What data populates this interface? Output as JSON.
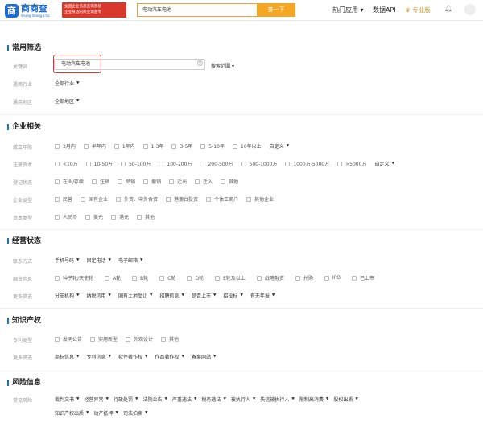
{
  "header": {
    "logo_text": "商商查",
    "logo_pinyin": "Shang Shang Cha",
    "logo_mark": "商",
    "promo_line1": "全国企业信息查询系统",
    "promo_line2": "企业身边的商业调查专",
    "search_value": "电动汽车电池",
    "search_button": "查一下",
    "nav_hot": "热门应用",
    "nav_api": "数据API",
    "nav_pro": "专业版"
  },
  "common": {
    "title": "常用筛选",
    "keyword_label": "关键词",
    "keyword_value": "电动汽车电池",
    "scope": "搜索范围",
    "industry_label": "通用行业",
    "industry_value": "全部行业",
    "region_label": "通用地区",
    "region_value": "全部地区"
  },
  "company": {
    "title": "企业相关",
    "rows": [
      {
        "label": "成立年限",
        "options": [
          "3月内",
          "半年内",
          "1年内",
          "1-3年",
          "3-5年",
          "5-10年",
          "10年以上"
        ],
        "dropdown": "自定义"
      },
      {
        "label": "注册资本",
        "options": [
          "<10万",
          "10-50万",
          "50-100万",
          "100-200万",
          "200-500万",
          "500-1000万",
          "1000万-5000万",
          ">5000万"
        ],
        "dropdown": "自定义"
      },
      {
        "label": "登记状态",
        "options": [
          "在业/存续",
          "注销",
          "吊销",
          "撤销",
          "迁出",
          "迁入",
          "其他"
        ]
      },
      {
        "label": "企业类型",
        "options": [
          "民营",
          "国有企业",
          "外资、中外合资",
          "港澳台投资",
          "个体工商户",
          "其他企业"
        ]
      },
      {
        "label": "资本类型",
        "options": [
          "人民币",
          "美元",
          "港元",
          "其他"
        ]
      }
    ]
  },
  "operation": {
    "title": "经营状态",
    "contact_label": "联系方式",
    "contact": [
      "手机号码",
      "固定电话",
      "电子邮箱"
    ],
    "financing_label": "融资信息",
    "financing": [
      "种子轮/天使轮",
      "A轮",
      "B轮",
      "C轮",
      "D轮",
      "E轮及以上",
      "战略融资",
      "并购",
      "IPO",
      "已上市"
    ],
    "more_label": "更多筛选",
    "more": [
      "分支机构",
      "纳税信用",
      "国有土地受让",
      "招聘信息",
      "是否上市",
      "招投标",
      "有无年报"
    ]
  },
  "ip": {
    "title": "知识产权",
    "patent_label": "专利类型",
    "patent": [
      "发明公告",
      "实用新型",
      "外观设计",
      "其他"
    ],
    "more_label": "更多筛选",
    "more": [
      "商标信息",
      "专利信息",
      "软件著作权",
      "作品著作权",
      "备案网站"
    ]
  },
  "risk": {
    "title": "风险信息",
    "label": "常见风险",
    "row1": [
      "裁判文书",
      "经营异常",
      "行政处罚",
      "法院公告",
      "严重违法",
      "税务违法",
      "被执行人",
      "失信被执行人",
      "限制高消费",
      "股权出质"
    ],
    "row2": [
      "知识产权出质",
      "动产抵押",
      "司法拍卖"
    ]
  },
  "colors": {
    "accent": "#1d6bd8",
    "search": "#f5a623",
    "highlight": "#d23b2f",
    "promo": "#d9382c"
  }
}
